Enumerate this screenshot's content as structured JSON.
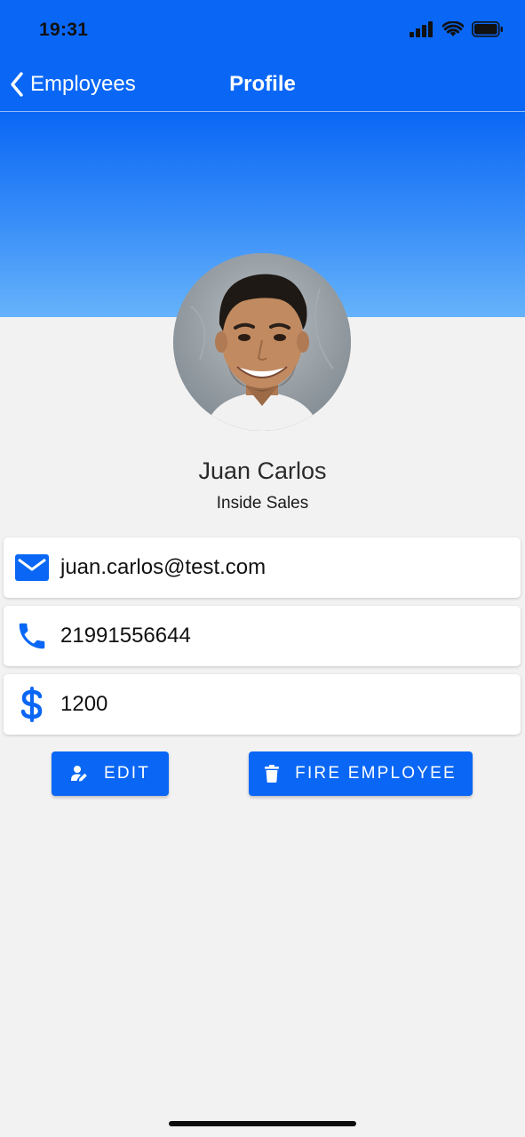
{
  "status_bar": {
    "time": "19:31",
    "icons": [
      "signal-icon",
      "wifi-icon",
      "battery-icon"
    ]
  },
  "nav": {
    "back_label": "Employees",
    "title": "Profile",
    "back_icon": "chevron-left-icon"
  },
  "profile": {
    "name": "Juan Carlos",
    "role": "Inside Sales"
  },
  "details": [
    {
      "icon": "mail-icon",
      "value": "juan.carlos@test.com"
    },
    {
      "icon": "phone-icon",
      "value": "21991556644"
    },
    {
      "icon": "dollar-icon",
      "value": "1200"
    }
  ],
  "actions": {
    "edit_label": "EDIT",
    "edit_icon": "edit-user-icon",
    "fire_label": "FIRE EMPLOYEE",
    "fire_icon": "trash-icon"
  },
  "colors": {
    "primary": "#0a67f5",
    "hero_gradient_end": "#66b3fb",
    "background": "#f2f2f2"
  }
}
